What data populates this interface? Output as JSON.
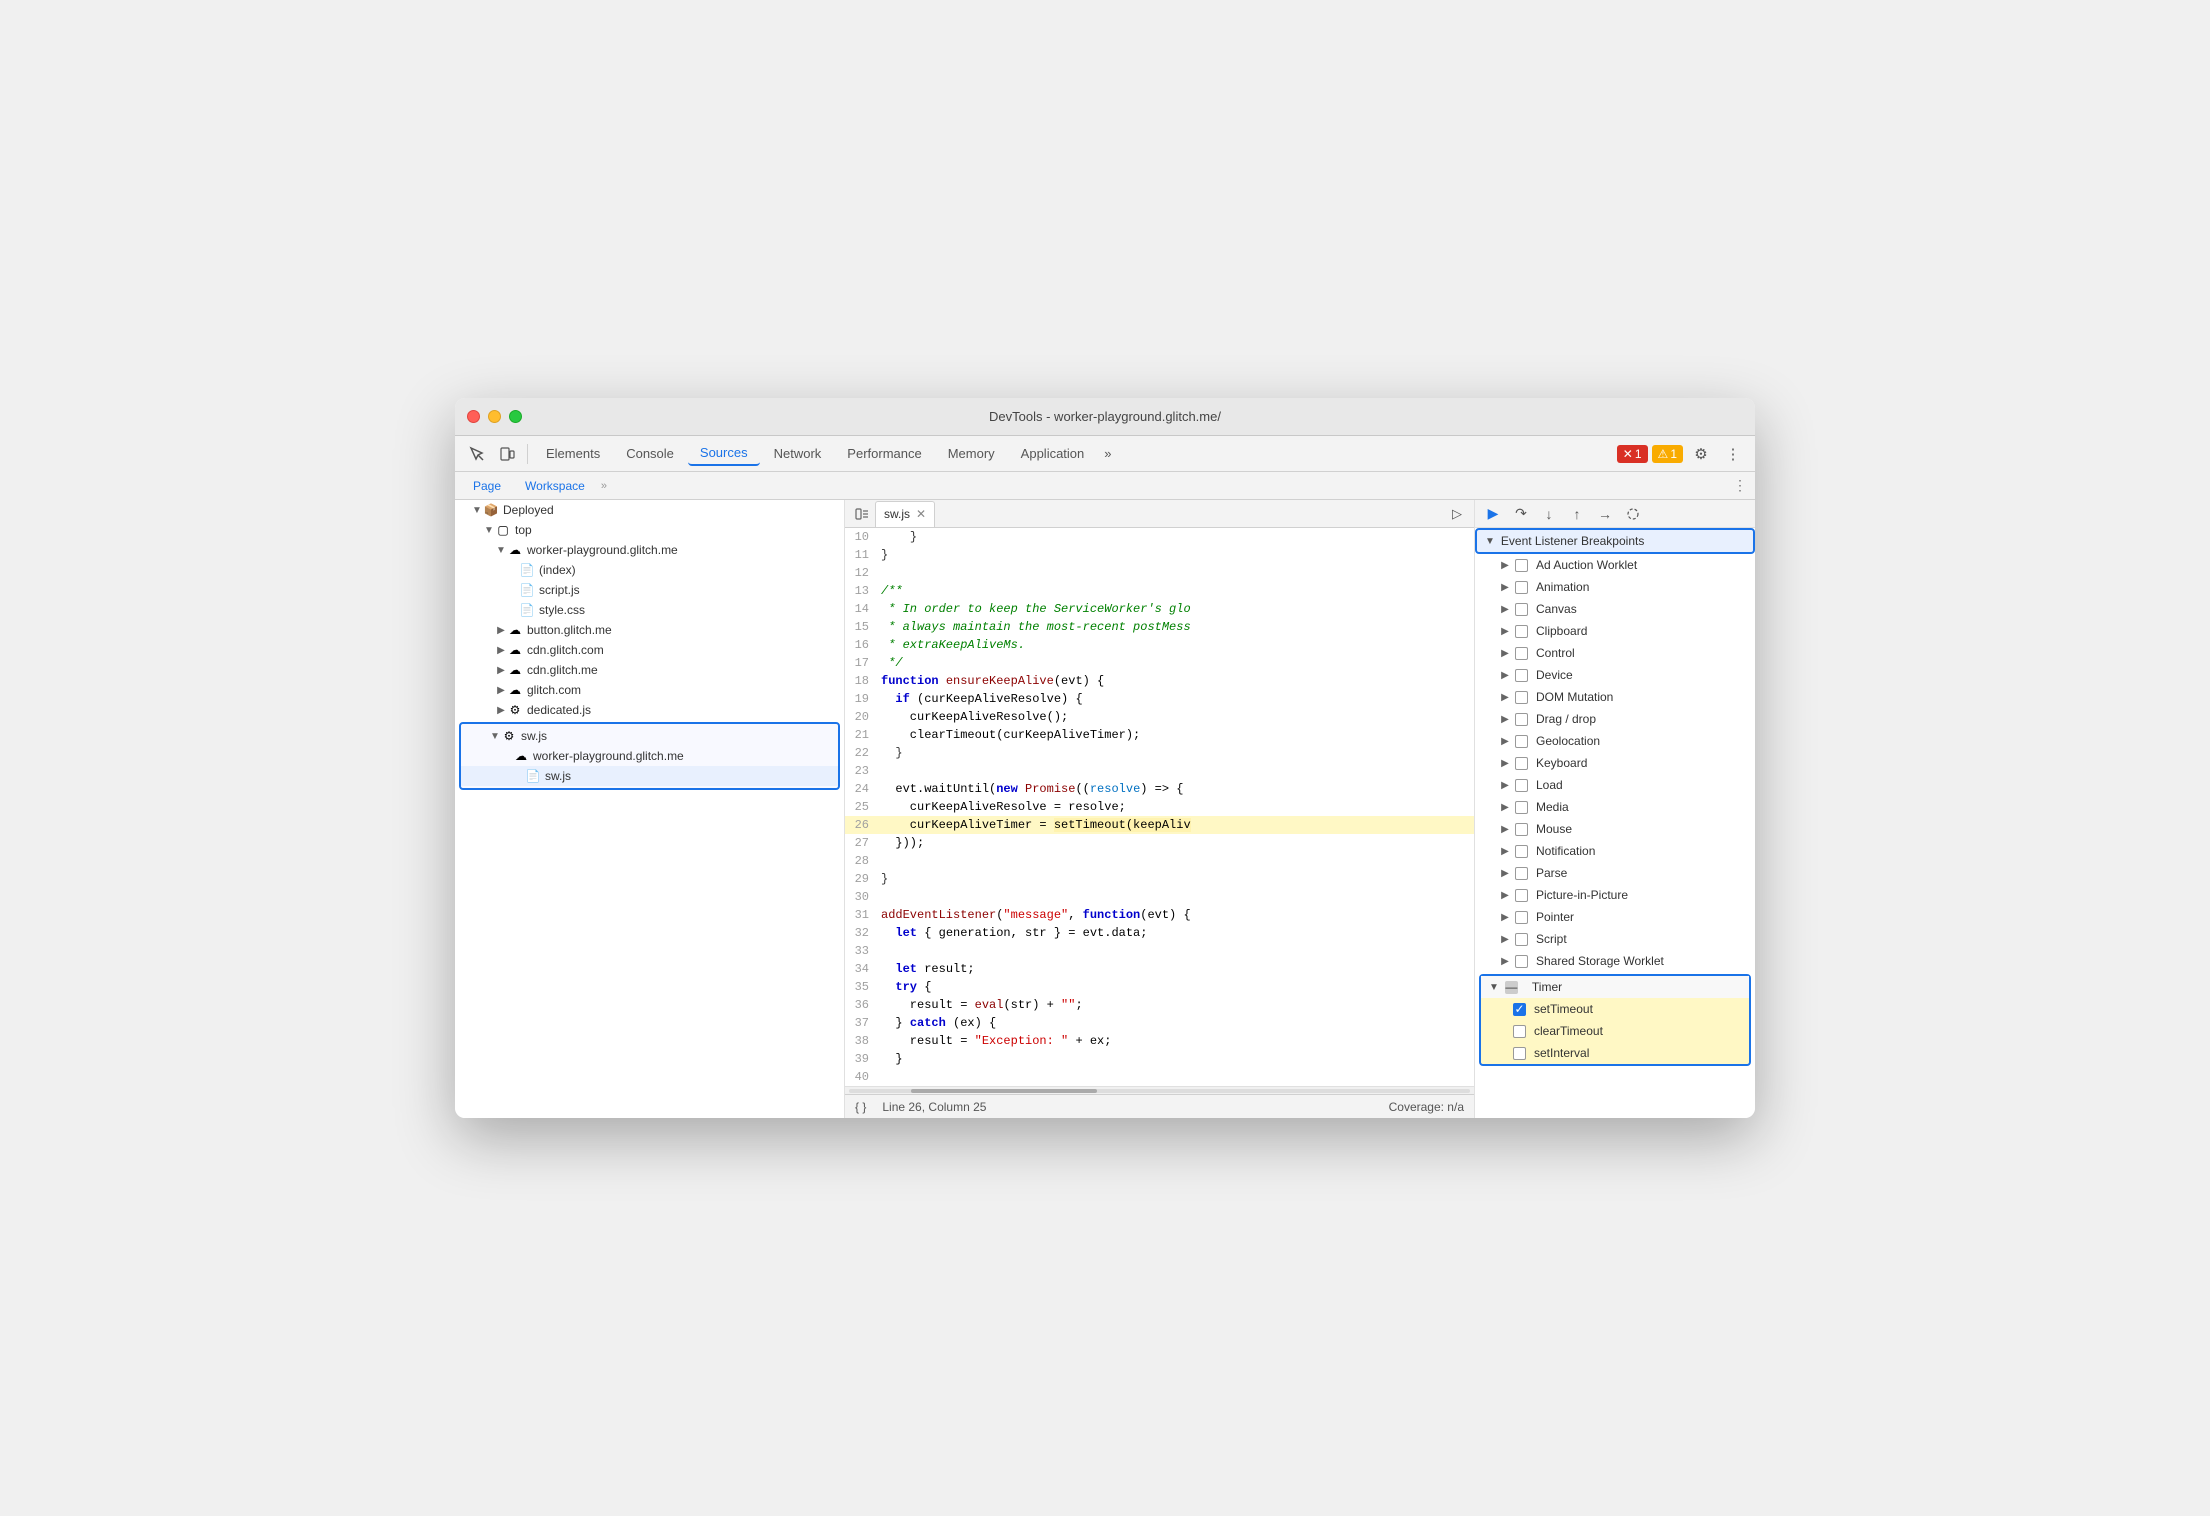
{
  "window": {
    "title": "DevTools - worker-playground.glitch.me/"
  },
  "toolbar": {
    "tabs": [
      {
        "label": "Elements",
        "active": false
      },
      {
        "label": "Console",
        "active": false
      },
      {
        "label": "Sources",
        "active": true
      },
      {
        "label": "Network",
        "active": false
      },
      {
        "label": "Performance",
        "active": false
      },
      {
        "label": "Memory",
        "active": false
      },
      {
        "label": "Application",
        "active": false
      },
      {
        "label": "»",
        "active": false
      }
    ],
    "errors": "1",
    "warnings": "1"
  },
  "sources_toolbar": {
    "page_tab": "Page",
    "workspace_tab": "Workspace",
    "more": "»"
  },
  "file_tree": {
    "items": [
      {
        "label": "Deployed",
        "type": "folder",
        "indent": 1,
        "expanded": true
      },
      {
        "label": "top",
        "type": "folder",
        "indent": 2,
        "expanded": true
      },
      {
        "label": "worker-playground.glitch.me",
        "type": "cloud-folder",
        "indent": 3,
        "expanded": true
      },
      {
        "label": "(index)",
        "type": "file",
        "indent": 4,
        "color": "gray"
      },
      {
        "label": "script.js",
        "type": "file",
        "indent": 4,
        "color": "orange"
      },
      {
        "label": "style.css",
        "type": "file",
        "indent": 4,
        "color": "purple"
      },
      {
        "label": "button.glitch.me",
        "type": "cloud-folder",
        "indent": 3,
        "expanded": false
      },
      {
        "label": "cdn.glitch.com",
        "type": "cloud-folder",
        "indent": 3,
        "expanded": false
      },
      {
        "label": "cdn.glitch.me",
        "type": "cloud-folder",
        "indent": 3,
        "expanded": false
      },
      {
        "label": "glitch.com",
        "type": "cloud-folder",
        "indent": 3,
        "expanded": false
      },
      {
        "label": "dedicated.js",
        "type": "gear-file",
        "indent": 3,
        "expanded": false
      },
      {
        "label": "sw.js",
        "type": "gear-file",
        "indent": 2,
        "expanded": true,
        "highlighted": true
      },
      {
        "label": "worker-playground.glitch.me",
        "type": "cloud-folder",
        "indent": 3,
        "highlighted": true
      },
      {
        "label": "sw.js",
        "type": "file-orange",
        "indent": 4,
        "highlighted": true
      }
    ]
  },
  "code": {
    "filename": "sw.js",
    "lines": [
      {
        "num": 10,
        "content": "    }"
      },
      {
        "num": 11,
        "content": "}"
      },
      {
        "num": 12,
        "content": ""
      },
      {
        "num": 13,
        "content": "/**"
      },
      {
        "num": 14,
        "content": " * In order to keep the ServiceWorker's glo"
      },
      {
        "num": 15,
        "content": " * always maintain the most-recent postMess"
      },
      {
        "num": 16,
        "content": " * extraKeepAliveMs."
      },
      {
        "num": 17,
        "content": " */"
      },
      {
        "num": 18,
        "content": "function ensureKeepAlive(evt) {"
      },
      {
        "num": 19,
        "content": "  if (curKeepAliveResolve) {"
      },
      {
        "num": 20,
        "content": "    curKeepAliveResolve();"
      },
      {
        "num": 21,
        "content": "    clearTimeout(curKeepAliveTimer);"
      },
      {
        "num": 22,
        "content": "  }"
      },
      {
        "num": 23,
        "content": ""
      },
      {
        "num": 24,
        "content": "  evt.waitUntil(new Promise((resolve) => {"
      },
      {
        "num": 25,
        "content": "    curKeepAliveResolve = resolve;"
      },
      {
        "num": 26,
        "content": "    curKeepAliveTimer = setTimeout(keepAliv",
        "highlighted": true
      },
      {
        "num": 27,
        "content": "  }));"
      },
      {
        "num": 28,
        "content": ""
      },
      {
        "num": 29,
        "content": "}"
      },
      {
        "num": 30,
        "content": ""
      },
      {
        "num": 31,
        "content": "addEventListener(\"message\", function(evt) {"
      },
      {
        "num": 32,
        "content": "  let { generation, str } = evt.data;"
      },
      {
        "num": 33,
        "content": ""
      },
      {
        "num": 34,
        "content": "  let result;"
      },
      {
        "num": 35,
        "content": "  try {"
      },
      {
        "num": 36,
        "content": "    result = eval(str) + \"\";"
      },
      {
        "num": 37,
        "content": "  } catch (ex) {"
      },
      {
        "num": 38,
        "content": "    result = \"Exception: \" + ex;"
      },
      {
        "num": 39,
        "content": "  }"
      },
      {
        "num": 40,
        "content": ""
      }
    ],
    "position": "Line 26, Column 25",
    "coverage": "Coverage: n/a"
  },
  "breakpoints": {
    "section_title": "Event Listener Breakpoints",
    "items": [
      {
        "label": "Ad Auction Worklet",
        "checked": false,
        "expanded": false
      },
      {
        "label": "Animation",
        "checked": false,
        "expanded": false
      },
      {
        "label": "Canvas",
        "checked": false,
        "expanded": false
      },
      {
        "label": "Clipboard",
        "checked": false,
        "expanded": false
      },
      {
        "label": "Control",
        "checked": false,
        "expanded": false
      },
      {
        "label": "Device",
        "checked": false,
        "expanded": false
      },
      {
        "label": "DOM Mutation",
        "checked": false,
        "expanded": false
      },
      {
        "label": "Drag / drop",
        "checked": false,
        "expanded": false
      },
      {
        "label": "Geolocation",
        "checked": false,
        "expanded": false
      },
      {
        "label": "Keyboard",
        "checked": false,
        "expanded": false
      },
      {
        "label": "Load",
        "checked": false,
        "expanded": false
      },
      {
        "label": "Media",
        "checked": false,
        "expanded": false
      },
      {
        "label": "Mouse",
        "checked": false,
        "expanded": false
      },
      {
        "label": "Notification",
        "checked": false,
        "expanded": false
      },
      {
        "label": "Parse",
        "checked": false,
        "expanded": false
      },
      {
        "label": "Picture-in-Picture",
        "checked": false,
        "expanded": false
      },
      {
        "label": "Pointer",
        "checked": false,
        "expanded": false
      },
      {
        "label": "Script",
        "checked": false,
        "expanded": false
      },
      {
        "label": "Shared Storage Worklet",
        "checked": false,
        "expanded": false
      },
      {
        "label": "Timer",
        "checked": false,
        "expanded": true,
        "highlighted": true
      },
      {
        "label": "setTimeout",
        "checked": true,
        "indent": true,
        "active": true
      },
      {
        "label": "clearTimeout",
        "checked": false,
        "indent": true
      },
      {
        "label": "setInterval",
        "checked": false,
        "indent": true
      }
    ]
  }
}
